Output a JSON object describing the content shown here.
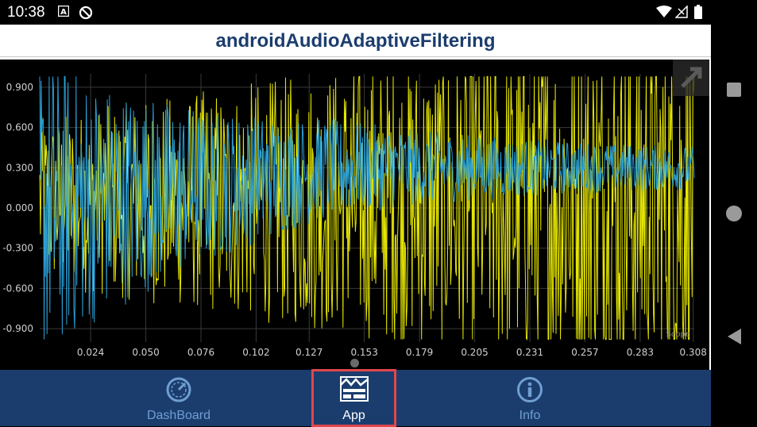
{
  "status_bar": {
    "time": "10:38",
    "icons": [
      "a-badge-icon",
      "no-sync-icon",
      "wifi-icon",
      "signal-icon",
      "battery-icon"
    ]
  },
  "app": {
    "title": "androidAudioAdaptiveFiltering",
    "colors": {
      "brand": "#1b3d6e",
      "tab_inactive": "#6f9fd1",
      "highlight": "#e0474c"
    }
  },
  "scope": {
    "label": "Scope",
    "expand_icon": "expand-arrow-icon"
  },
  "chart_data": {
    "type": "line",
    "title": "",
    "xlabel": "",
    "ylabel": "",
    "xlim": [
      0.0,
      0.3085
    ],
    "ylim": [
      -1.0,
      1.0
    ],
    "y_ticks": [
      "0.900",
      "0.600",
      "0.300",
      "0.000",
      "-0.300",
      "-0.600",
      "-0.900"
    ],
    "x_ticks": [
      "0.024",
      "0.050",
      "0.076",
      "0.102",
      "0.127",
      "0.153",
      "0.179",
      "0.205",
      "0.231",
      "0.257",
      "0.283",
      "0.308"
    ],
    "grid": true,
    "series": [
      {
        "color": "#e6e600",
        "description_values": "dense audio waveform, amplitude grows from about ±0.6 to ±1.0 (clipped) over time"
      },
      {
        "color": "#2a9fd6",
        "description_values": "dense audio waveform, large early amplitude (±1.0) decaying and settling around 0.3 by the end"
      }
    ]
  },
  "tabs": [
    {
      "label": "DashBoard",
      "icon": "speedometer-icon",
      "selected": false
    },
    {
      "label": "App",
      "icon": "app-waveform-icon",
      "selected": true
    },
    {
      "label": "Info",
      "icon": "info-icon",
      "selected": false
    }
  ],
  "nav": [
    "overview-square-icon",
    "home-circle-icon",
    "back-triangle-icon"
  ]
}
